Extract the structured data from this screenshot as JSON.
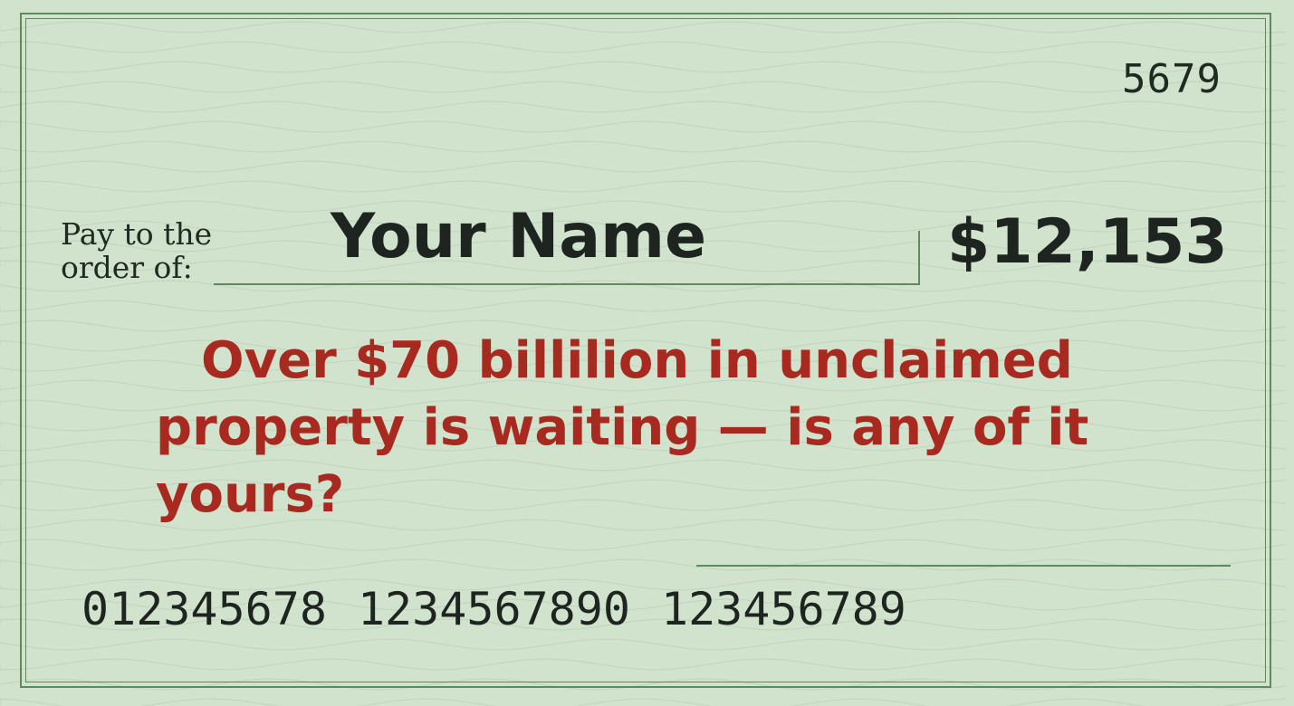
{
  "check": {
    "number": "5679",
    "pay_label_line1": "Pay to the",
    "pay_label_line2": "order of:",
    "payee_name": "Your Name",
    "amount": "$12,153",
    "headline_line1": "Over $70 billilion in unclaimed",
    "headline_line2": "property is waiting — is any of it yours?",
    "micr": {
      "routing": "012345678",
      "account": "1234567890",
      "serial": "123456789"
    }
  },
  "colors": {
    "background": "#d2e3cd",
    "border": "#5d8a5f",
    "text": "#1e2521",
    "headline": "#a8291f"
  }
}
